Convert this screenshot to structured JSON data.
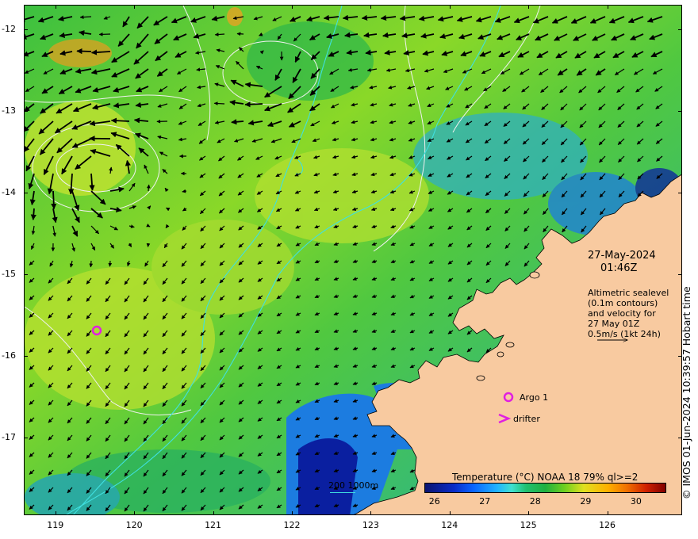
{
  "map": {
    "y_ticks": [
      "-12",
      "-13",
      "-14",
      "-15",
      "-16",
      "-17"
    ],
    "x_ticks": [
      "119",
      "120",
      "121",
      "122",
      "123",
      "124",
      "125",
      "126"
    ],
    "lon_range": [
      118.6,
      126.95
    ],
    "lat_range": [
      -17.95,
      -11.7
    ]
  },
  "annotations": {
    "date": "27-May-2024",
    "time": "01:46Z",
    "altimetry_lines": [
      "Altimetric sealevel",
      "(0.1m contours)",
      "and velocity for",
      "27 May 01Z",
      "0.5m/s (1kt 24h)"
    ]
  },
  "legend": {
    "argo": "Argo 1",
    "drifter": "drifter",
    "isobath": "200  1000m",
    "argo_color": "#e020e0",
    "drifter_color": "#e020e0",
    "isobath_color": "#40e0e0"
  },
  "colorbar": {
    "title": "Temperature (°C) NOAA 18 79% ql>=2",
    "ticks": [
      "26",
      "27",
      "28",
      "29",
      "30"
    ],
    "range": [
      25.8,
      30.6
    ]
  },
  "credit": "© IMOS 01-Jun-2024 10:39:57 Hobart time",
  "colors": {
    "land": "#f8caa0",
    "ocean_warm": "#7ed62a",
    "ocean_mid": "#22b850",
    "ocean_cool": "#1ca0c8",
    "ocean_cold": "#0a1fa0",
    "arrow": "#000000"
  }
}
